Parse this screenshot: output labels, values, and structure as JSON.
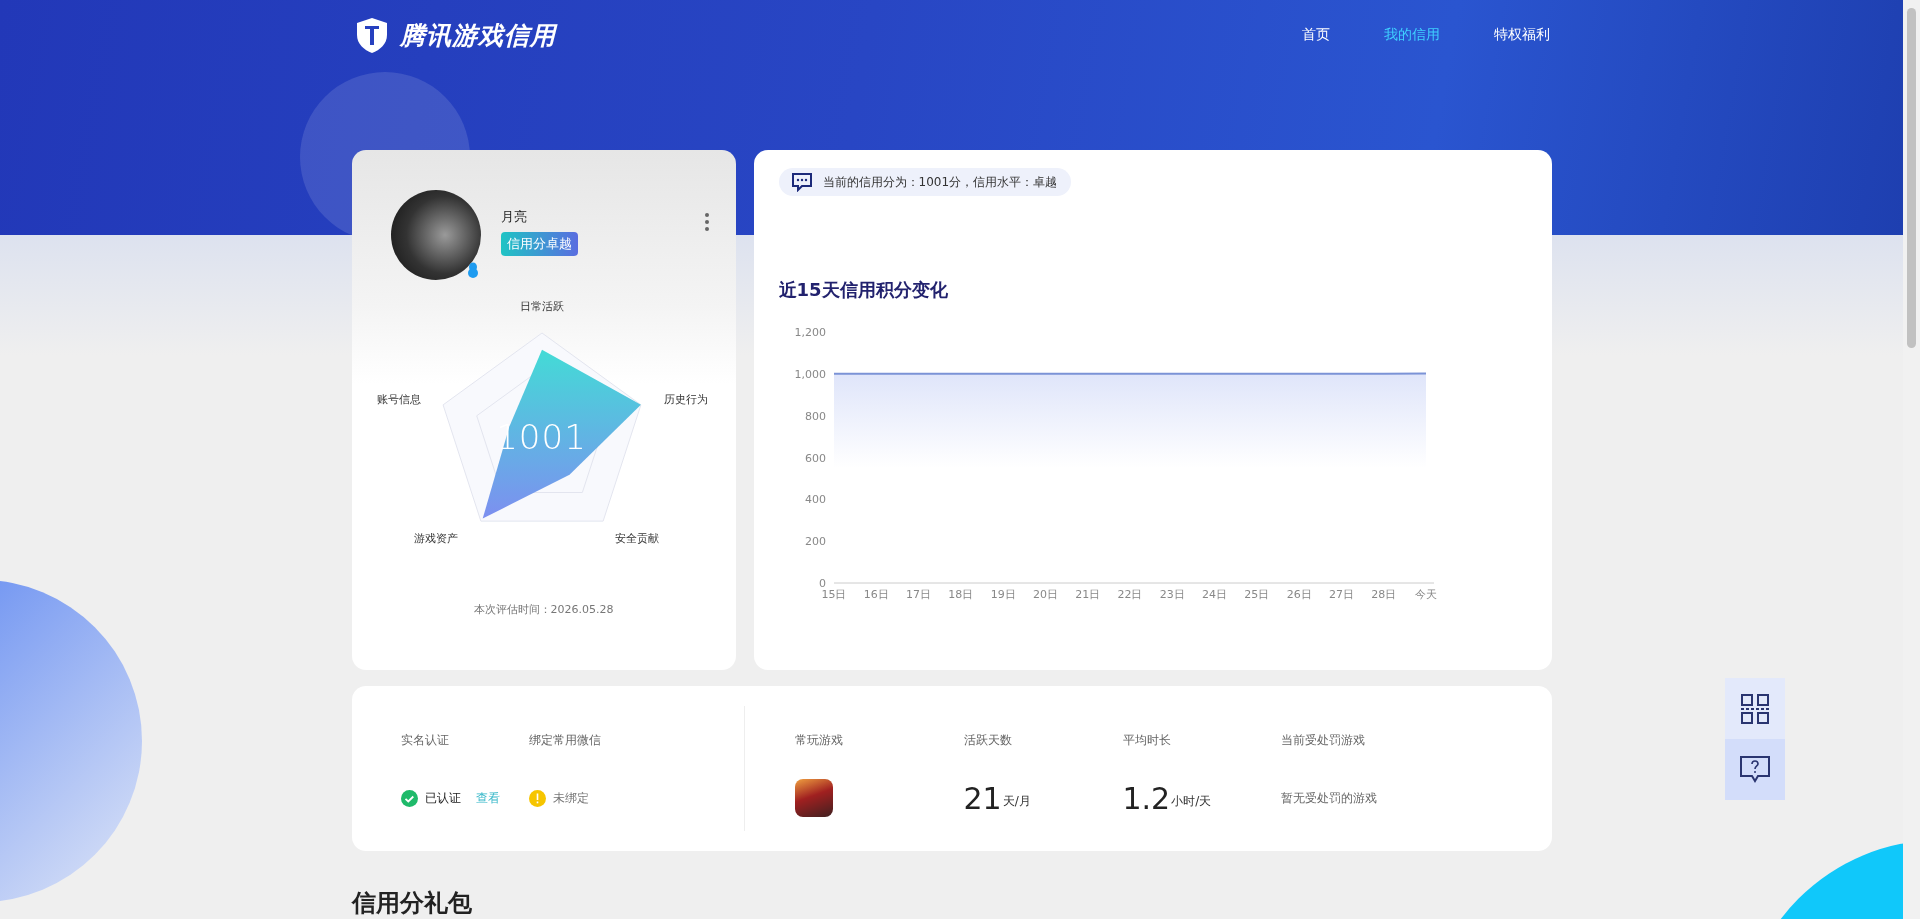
{
  "header": {
    "logo_text": "腾讯游戏信用",
    "nav": [
      {
        "label": "首页",
        "selected": false
      },
      {
        "label": "我的信用",
        "selected": true
      },
      {
        "label": "特权福利",
        "selected": false
      }
    ]
  },
  "profile": {
    "name": "月亮",
    "badge": "信用分卓越",
    "radar": {
      "axes": [
        "日常活跃",
        "历史行为",
        "安全贡献",
        "游戏资产",
        "账号信息"
      ],
      "score": "1001"
    },
    "eval_time": "本次评估时间：2026.05.28"
  },
  "trend": {
    "notice": "当前的信用分为：1001分，信用水平：卓越",
    "title": "近15天信用积分变化",
    "chart_data": {
      "type": "area",
      "categories": [
        "15日",
        "16日",
        "17日",
        "18日",
        "19日",
        "20日",
        "21日",
        "22日",
        "23日",
        "24日",
        "25日",
        "26日",
        "27日",
        "28日",
        "今天"
      ],
      "series": [
        {
          "color": "#7b93d6",
          "values": [
            1000,
            1000,
            1000,
            1000,
            1000,
            1000,
            1000,
            1000,
            1000,
            1000,
            1000,
            1000,
            1000,
            1000,
            1001
          ]
        }
      ],
      "ylim": [
        0,
        1200
      ],
      "yticks": [
        0,
        200,
        400,
        600,
        800,
        {
          "value": 1000,
          "label": "1,000"
        },
        {
          "value": 1200,
          "label": "1,200"
        }
      ]
    }
  },
  "info": {
    "verification": [
      {
        "label": "实名认证",
        "status": "已认证",
        "kind": "ok",
        "link": "查看"
      },
      {
        "label": "绑定常用微信",
        "status": "未绑定",
        "kind": "warn"
      }
    ],
    "stats": [
      {
        "label": "常玩游戏",
        "kind": "game"
      },
      {
        "label": "活跃天数",
        "kind": "number",
        "value": "21",
        "unit": "天/月"
      },
      {
        "label": "平均时长",
        "kind": "number",
        "value": "1.2",
        "unit": "小时/天"
      },
      {
        "label": "当前受处罚游戏",
        "kind": "text",
        "value": "暂无受处罚的游戏"
      }
    ]
  },
  "gift_section": {
    "title": "信用分礼包"
  }
}
